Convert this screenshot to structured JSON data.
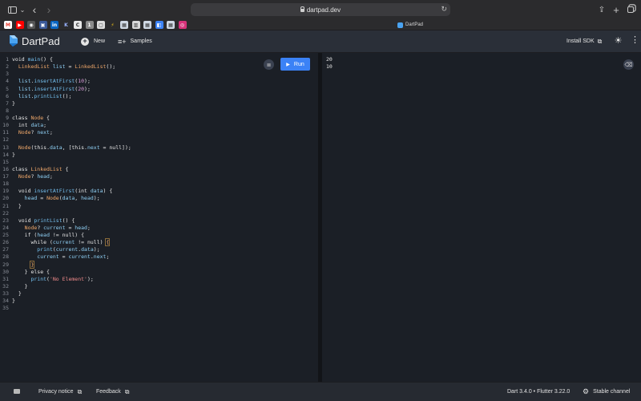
{
  "browser": {
    "url": "dartpad.dev",
    "active_tab_title": "DartPad",
    "favorites": [
      {
        "name": "gmail",
        "label": "M",
        "color": "#ffffff",
        "text_color": "#ea4335"
      },
      {
        "name": "youtube",
        "label": "▶",
        "color": "#ff0000",
        "text_color": "#ffffff"
      },
      {
        "name": "site-3",
        "label": "◉",
        "color": "#555555",
        "text_color": "#ffffff"
      },
      {
        "name": "site-4",
        "label": "▣",
        "color": "#3b5998",
        "text_color": "#ffffff"
      },
      {
        "name": "linkedin",
        "label": "in",
        "color": "#0a66c2",
        "text_color": "#ffffff"
      },
      {
        "name": "site-6",
        "label": "K",
        "color": "#2b2b2d",
        "text_color": "#9ab4ff"
      },
      {
        "name": "site-7",
        "label": "C",
        "color": "#e8e8e8",
        "text_color": "#333333"
      },
      {
        "name": "site-8",
        "label": "1",
        "color": "#8a8a8a",
        "text_color": "#ffffff"
      },
      {
        "name": "site-9",
        "label": "▢",
        "color": "#dcdcdc",
        "text_color": "#333333"
      },
      {
        "name": "site-10",
        "label": "⚡",
        "color": "#2b2b2d",
        "text_color": "#f5c518"
      },
      {
        "name": "site-11",
        "label": "▦",
        "color": "#cfd8e3",
        "text_color": "#333333"
      },
      {
        "name": "site-12",
        "label": "▥",
        "color": "#d8d8d8",
        "text_color": "#333333"
      },
      {
        "name": "site-13",
        "label": "▦",
        "color": "#cfd8e3",
        "text_color": "#333333"
      },
      {
        "name": "site-14",
        "label": "◧",
        "color": "#3b82f6",
        "text_color": "#ffffff"
      },
      {
        "name": "site-15",
        "label": "▦",
        "color": "#cfd8e3",
        "text_color": "#333333"
      },
      {
        "name": "instagram",
        "label": "◎",
        "color": "#d6337a",
        "text_color": "#ffffff"
      }
    ]
  },
  "header": {
    "title": "DartPad",
    "new_label": "New",
    "samples_label": "Samples",
    "install_sdk_label": "Install SDK"
  },
  "editor": {
    "run_label": "Run",
    "lines": [
      [
        [
          "k",
          "void "
        ],
        [
          "f",
          "main"
        ],
        [
          "",
          "() {"
        ]
      ],
      [
        [
          "t",
          "  LinkedList "
        ],
        [
          "v",
          "list"
        ],
        [
          "",
          " = "
        ],
        [
          "t",
          "LinkedList"
        ],
        [
          "",
          "();"
        ]
      ],
      [
        [
          "",
          ""
        ]
      ],
      [
        [
          "v",
          "  list"
        ],
        [
          "",
          "."
        ],
        [
          "f",
          "insertAtFirst"
        ],
        [
          "",
          "("
        ],
        [
          "n",
          "10"
        ],
        [
          "",
          ");"
        ]
      ],
      [
        [
          "v",
          "  list"
        ],
        [
          "",
          "."
        ],
        [
          "f",
          "insertAtFirst"
        ],
        [
          "",
          "("
        ],
        [
          "n",
          "20"
        ],
        [
          "",
          ");"
        ]
      ],
      [
        [
          "v",
          "  list"
        ],
        [
          "",
          "."
        ],
        [
          "f",
          "printList"
        ],
        [
          "",
          "();"
        ]
      ],
      [
        [
          "",
          "}"
        ]
      ],
      [
        [
          "",
          ""
        ]
      ],
      [
        [
          "k",
          "class "
        ],
        [
          "t",
          "Node"
        ],
        [
          "",
          " {"
        ]
      ],
      [
        [
          "k",
          "  int "
        ],
        [
          "v",
          "data"
        ],
        [
          "",
          ";"
        ]
      ],
      [
        [
          "t",
          "  Node"
        ],
        [
          "",
          "? "
        ],
        [
          "v",
          "next"
        ],
        [
          "",
          ";"
        ]
      ],
      [
        [
          "",
          ""
        ]
      ],
      [
        [
          "t",
          "  Node"
        ],
        [
          "",
          "("
        ],
        [
          "k",
          "this"
        ],
        [
          "",
          "."
        ],
        [
          "v",
          "data"
        ],
        [
          "",
          ", ["
        ],
        [
          "k",
          "this"
        ],
        [
          "",
          "."
        ],
        [
          "v",
          "next"
        ],
        [
          "",
          " = "
        ],
        [
          "k",
          "null"
        ],
        [
          "",
          "]);"
        ]
      ],
      [
        [
          "",
          "}"
        ]
      ],
      [
        [
          "",
          ""
        ]
      ],
      [
        [
          "k",
          "class "
        ],
        [
          "t",
          "LinkedList"
        ],
        [
          "",
          " {"
        ]
      ],
      [
        [
          "t",
          "  Node"
        ],
        [
          "",
          "? "
        ],
        [
          "v",
          "head"
        ],
        [
          "",
          ";"
        ]
      ],
      [
        [
          "",
          ""
        ]
      ],
      [
        [
          "k",
          "  void "
        ],
        [
          "f",
          "insertAtFirst"
        ],
        [
          "",
          "("
        ],
        [
          "k",
          "int "
        ],
        [
          "v",
          "data"
        ],
        [
          "",
          ") {"
        ]
      ],
      [
        [
          "v",
          "    head"
        ],
        [
          "",
          " = "
        ],
        [
          "t",
          "Node"
        ],
        [
          "",
          "("
        ],
        [
          "v",
          "data"
        ],
        [
          "",
          ", "
        ],
        [
          "v",
          "head"
        ],
        [
          "",
          ");"
        ]
      ],
      [
        [
          "",
          "  }"
        ]
      ],
      [
        [
          "",
          ""
        ]
      ],
      [
        [
          "k",
          "  void "
        ],
        [
          "f",
          "printList"
        ],
        [
          "",
          "() {"
        ]
      ],
      [
        [
          "t",
          "    Node"
        ],
        [
          "",
          "? "
        ],
        [
          "v",
          "current"
        ],
        [
          "",
          " = "
        ],
        [
          "v",
          "head"
        ],
        [
          "",
          ";"
        ]
      ],
      [
        [
          "k",
          "    if "
        ],
        [
          "",
          "("
        ],
        [
          "v",
          "head"
        ],
        [
          "",
          " != "
        ],
        [
          "k",
          "null"
        ],
        [
          "",
          ") {"
        ]
      ],
      [
        [
          "k",
          "      while "
        ],
        [
          "",
          "("
        ],
        [
          "v",
          "current"
        ],
        [
          "",
          " != "
        ],
        [
          "k",
          "null"
        ],
        [
          "",
          ") "
        ],
        [
          "bm",
          "{"
        ]
      ],
      [
        [
          "f",
          "        print"
        ],
        [
          "",
          "("
        ],
        [
          "v",
          "current"
        ],
        [
          "",
          "."
        ],
        [
          "v",
          "data"
        ],
        [
          "",
          ");"
        ]
      ],
      [
        [
          "v",
          "        current"
        ],
        [
          "",
          " = "
        ],
        [
          "v",
          "current"
        ],
        [
          "",
          "."
        ],
        [
          "v",
          "next"
        ],
        [
          "",
          ";"
        ]
      ],
      [
        [
          "",
          "      "
        ],
        [
          "bm",
          "}"
        ]
      ],
      [
        [
          "",
          "    } "
        ],
        [
          "k",
          "else"
        ],
        [
          "",
          " {"
        ]
      ],
      [
        [
          "f",
          "      print"
        ],
        [
          "",
          "("
        ],
        [
          "s",
          "'No Element'"
        ],
        [
          "",
          ");"
        ]
      ],
      [
        [
          "",
          "    }"
        ]
      ],
      [
        [
          "",
          "  }"
        ]
      ],
      [
        [
          "",
          "}"
        ]
      ],
      [
        [
          "",
          ""
        ]
      ]
    ]
  },
  "output": {
    "lines": [
      "20",
      "10"
    ]
  },
  "footer": {
    "privacy_label": "Privacy notice",
    "feedback_label": "Feedback",
    "versions": "Dart 3.4.0 • Flutter 3.22.0",
    "channel_label": "Stable channel"
  },
  "colors": {
    "accent": "#3b82f6",
    "editor_bg": "#1b1f26",
    "header_bg": "#2a2f38"
  }
}
